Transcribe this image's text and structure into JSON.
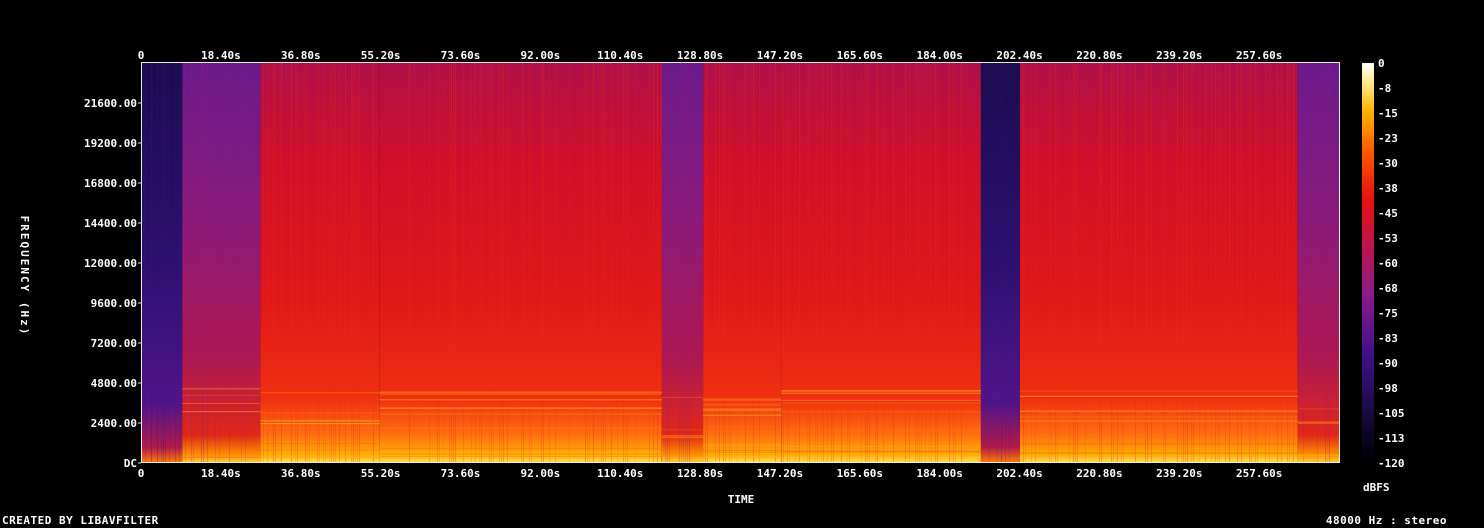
{
  "chart_data": {
    "type": "heatmap",
    "xlabel": "TIME",
    "ylabel": "FREQUENCY (Hz)",
    "x_ticks": [
      "0",
      "18.40s",
      "36.80s",
      "55.20s",
      "73.60s",
      "92.00s",
      "110.40s",
      "128.80s",
      "147.20s",
      "165.60s",
      "184.00s",
      "202.40s",
      "220.80s",
      "239.20s",
      "257.60s"
    ],
    "y_ticks": [
      "DC",
      "2400.00",
      "4800.00",
      "7200.00",
      "9600.00",
      "12000.00",
      "14400.00",
      "16800.00",
      "19200.00",
      "21600.00"
    ],
    "x_range_s": [
      0,
      276
    ],
    "y_range_hz": [
      0,
      24000
    ],
    "colorbar": {
      "label": "dBFS",
      "ticks": [
        "0",
        "-8",
        "-15",
        "-23",
        "-30",
        "-38",
        "-45",
        "-53",
        "-60",
        "-68",
        "-75",
        "-83",
        "-90",
        "-98",
        "-105",
        "-113",
        "-120"
      ],
      "range": [
        -120,
        0
      ]
    },
    "segments": [
      {
        "start_s": 0,
        "end_s": 9.5,
        "energy": "low"
      },
      {
        "start_s": 9.5,
        "end_s": 27.5,
        "energy": "medium"
      },
      {
        "start_s": 27.5,
        "end_s": 55,
        "energy": "high"
      },
      {
        "start_s": 55,
        "end_s": 120,
        "energy": "high"
      },
      {
        "start_s": 120,
        "end_s": 129.5,
        "energy": "medium"
      },
      {
        "start_s": 129.5,
        "end_s": 147.5,
        "energy": "high"
      },
      {
        "start_s": 147.5,
        "end_s": 193.5,
        "energy": "high"
      },
      {
        "start_s": 193.5,
        "end_s": 202.5,
        "energy": "low"
      },
      {
        "start_s": 202.5,
        "end_s": 266.5,
        "energy": "high"
      },
      {
        "start_s": 266.5,
        "end_s": 276,
        "energy": "medium"
      }
    ]
  },
  "footer": {
    "left": "CREATED BY LIBAVFILTER",
    "right": "48000 Hz : stereo"
  },
  "colors": {
    "background": "#000000",
    "gradient": [
      "#000000",
      "#1b0c4a",
      "#45108a",
      "#8a1a8a",
      "#c0144a",
      "#e61010",
      "#ff5a00",
      "#ffb400",
      "#fff0a0",
      "#ffffff"
    ]
  }
}
